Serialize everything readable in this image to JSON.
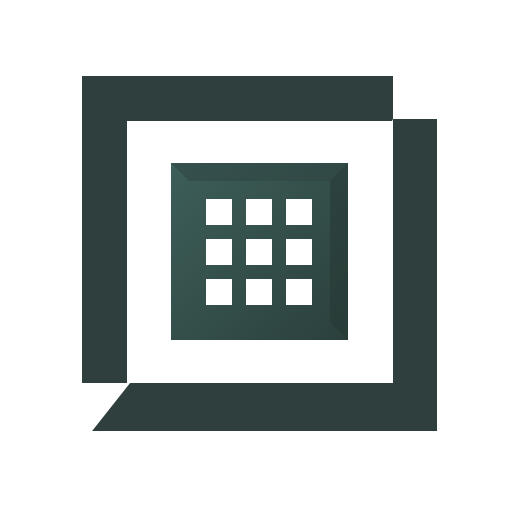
{
  "logo": {
    "icon": "grid-frame-logo-icon",
    "colors": {
      "frame": "#2f3f3d",
      "inner_light": "#3d5e59",
      "inner_dark": "#2b403c",
      "cells": "#ffffff",
      "background": "#ffffff"
    }
  }
}
